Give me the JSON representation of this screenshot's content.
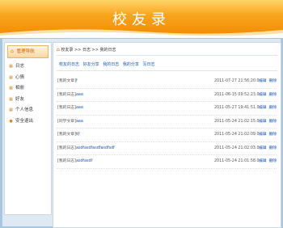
{
  "header": {
    "title": "校友录"
  },
  "sidebar": {
    "title": "管理导航",
    "items": [
      {
        "label": "日志"
      },
      {
        "label": "心情"
      },
      {
        "label": "相册"
      },
      {
        "label": "好友"
      },
      {
        "label": "个人信息"
      },
      {
        "label": "安全退出"
      }
    ]
  },
  "breadcrumb": {
    "text": "校友录 >> 日志 >> 我的日志"
  },
  "tabs": [
    {
      "label": "校友的日志"
    },
    {
      "label": "好友分享"
    },
    {
      "label": "我的日志"
    },
    {
      "label": "我的分享"
    },
    {
      "label": "写日志"
    }
  ],
  "entries": [
    {
      "category": "[我的文章]",
      "subject": "f",
      "date": "2011-07-27 21:56:20.0",
      "edit": "编辑",
      "delete": "删除"
    },
    {
      "category": "[我的日志]",
      "subject": "aaa",
      "date": "2011-06-15 09:52:23.0",
      "edit": "编辑",
      "delete": "删除"
    },
    {
      "category": "[我的日志]",
      "subject": "aaa",
      "date": "2011-05-27 19:41:51.0",
      "edit": "编辑",
      "delete": "删除"
    },
    {
      "category": "[同学文章]",
      "subject": "aaa",
      "date": "2011-05-24 21:02:15.0",
      "edit": "编辑",
      "delete": "删除"
    },
    {
      "category": "[我的文章]",
      "subject": "好",
      "date": "2011-05-24 21:02:09.0",
      "edit": "编辑",
      "delete": "删除"
    },
    {
      "category": "[我的日志]",
      "subject": "asdfasdfasdfasdfsdf",
      "date": "2011-05-24 21:02:03.0",
      "edit": "编辑",
      "delete": "删除"
    },
    {
      "category": "[我的日志]",
      "subject": "asdfasdf",
      "date": "2011-05-24 21:01:58.0",
      "edit": "编辑",
      "delete": "删除"
    }
  ]
}
